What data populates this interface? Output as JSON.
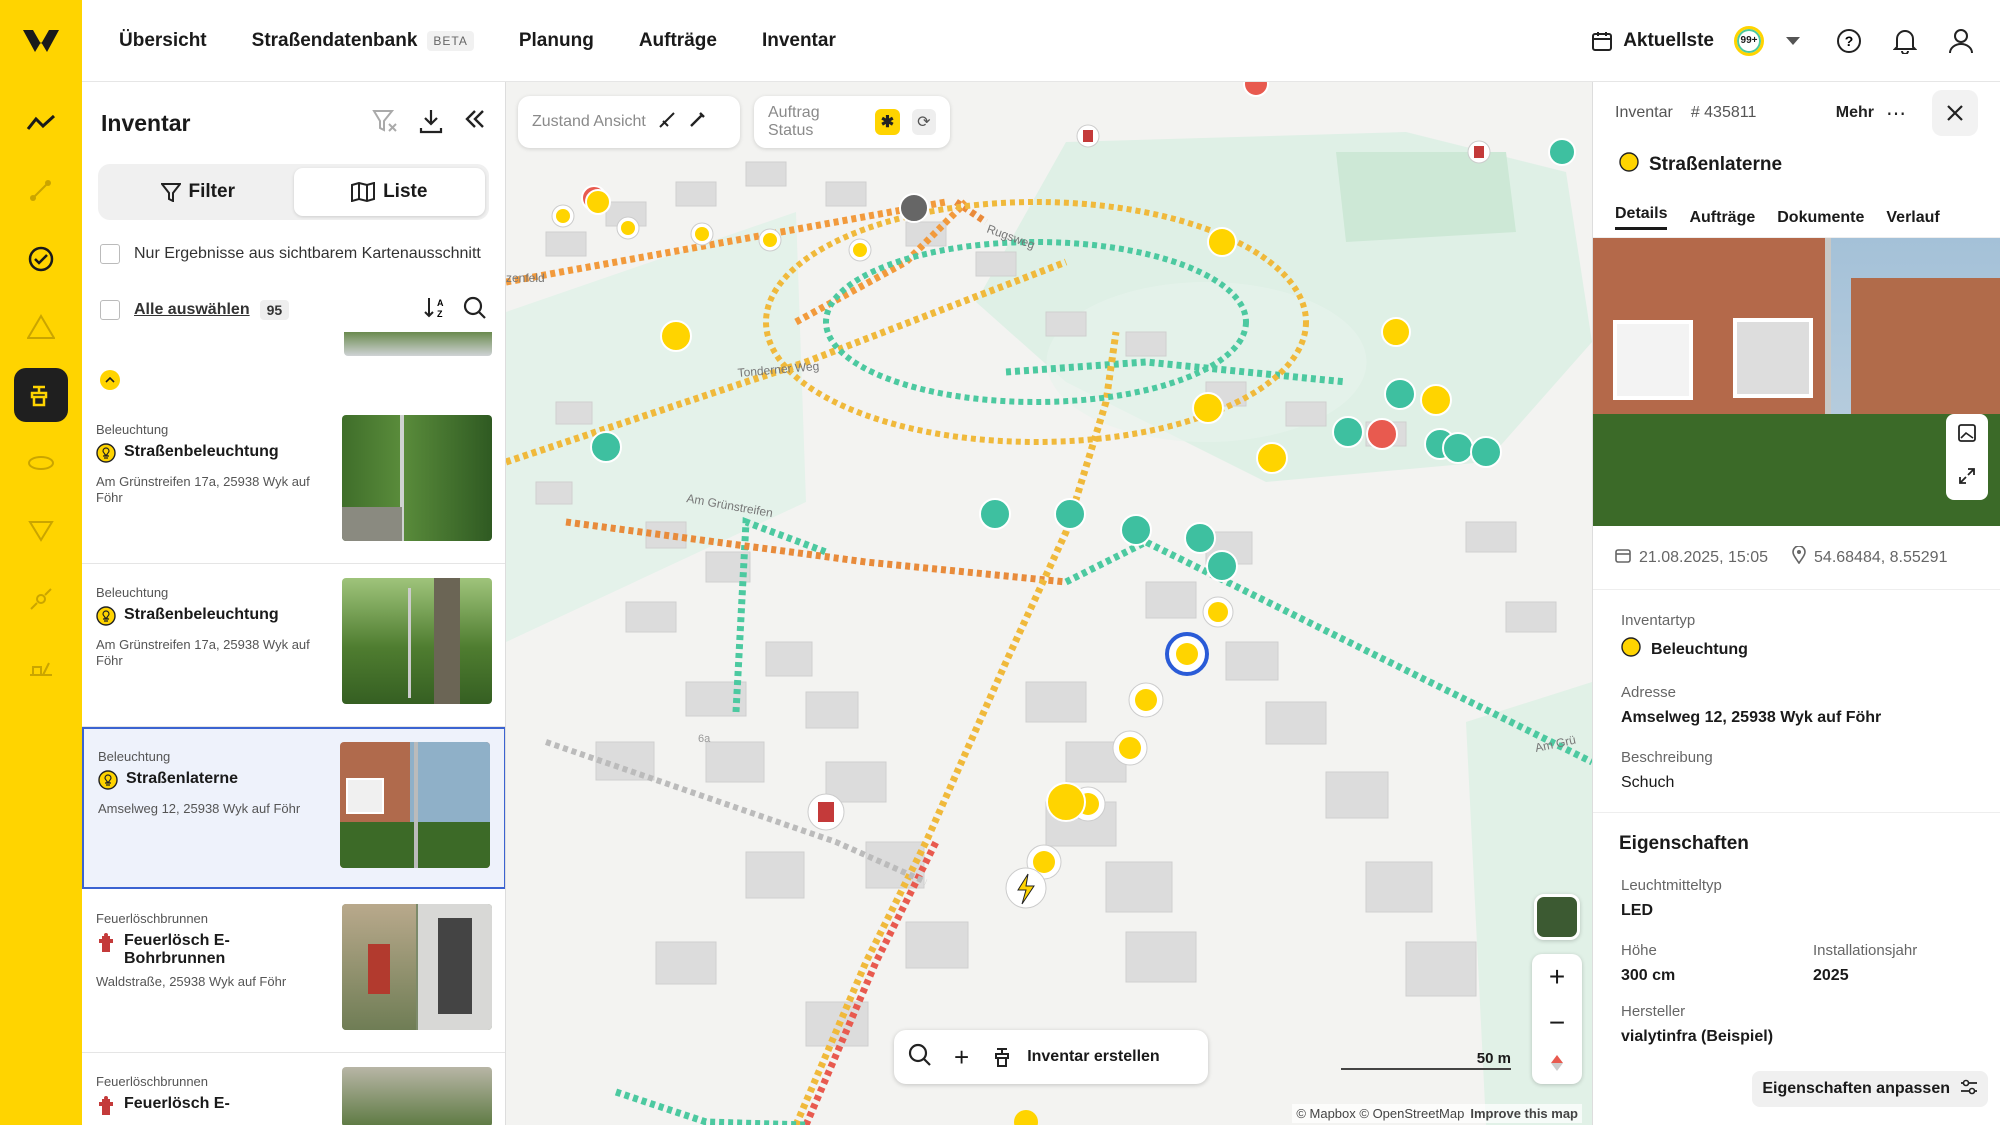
{
  "nav": {
    "items": [
      "Übersicht",
      "Straßendatenbank",
      "Planung",
      "Aufträge",
      "Inventar"
    ],
    "beta": "BETA",
    "date_label": "Aktuellste",
    "notif_badge": "99+"
  },
  "inventory": {
    "title": "Inventar",
    "tab_filter": "Filter",
    "tab_list": "Liste",
    "visible_only": "Nur Ergebnisse aus sichtbarem Kartenausschnitt",
    "select_all": "Alle auswählen",
    "count": "95",
    "items": [
      {
        "category": "Beleuchtung",
        "title": "Straßenbeleuchtung",
        "address": "Am Grünstreifen 17a, 25938 Wyk auf Föhr"
      },
      {
        "category": "Beleuchtung",
        "title": "Straßenbeleuchtung",
        "address": "Am Grünstreifen 17a, 25938 Wyk auf Föhr"
      },
      {
        "category": "Beleuchtung",
        "title": "Straßenlaterne",
        "address": "Amselweg 12, 25938 Wyk auf Föhr"
      },
      {
        "category": "Feuerlöschbrunnen",
        "title": "Feuerlösch E-Bohrbrunnen",
        "address": "Waldstraße, 25938 Wyk auf Föhr"
      },
      {
        "category": "Feuerlöschbrunnen",
        "title": "Feuerlösch E-",
        "address": ""
      }
    ]
  },
  "map": {
    "chip_zustand": "Zustand Ansicht",
    "chip_auftrag": "Auftrag Status",
    "create_label": "Inventar erstellen",
    "scale": "50 m",
    "attribution": "© Mapbox © OpenStreetMap",
    "improve": "Improve this map",
    "street_labels": [
      "Tonderner Weg",
      "Am Grünstreifen",
      "Rugsweg",
      "zenfeld",
      "Am Grü",
      "6a"
    ]
  },
  "detail": {
    "section": "Inventar",
    "id": "# 435811",
    "more": "Mehr",
    "title": "Straßenlaterne",
    "tabs": [
      "Details",
      "Aufträge",
      "Dokumente",
      "Verlauf"
    ],
    "datetime": "21.08.2025, 15:05",
    "coords": "54.68484, 8.55291",
    "type_label": "Inventartyp",
    "type_value": "Beleuchtung",
    "address_label": "Adresse",
    "address_value": "Amselweg 12, 25938 Wyk auf Föhr",
    "desc_label": "Beschreibung",
    "desc_value": "Schuch",
    "props_title": "Eigenschaften",
    "lamp_label": "Leuchtmitteltyp",
    "lamp_value": "LED",
    "height_label": "Höhe",
    "height_value": "300 cm",
    "year_label": "Installationsjahr",
    "year_value": "2025",
    "maker_label": "Hersteller",
    "maker_value": "vialytinfra (Beispiel)",
    "adjust": "Eigenschaften anpassen"
  }
}
